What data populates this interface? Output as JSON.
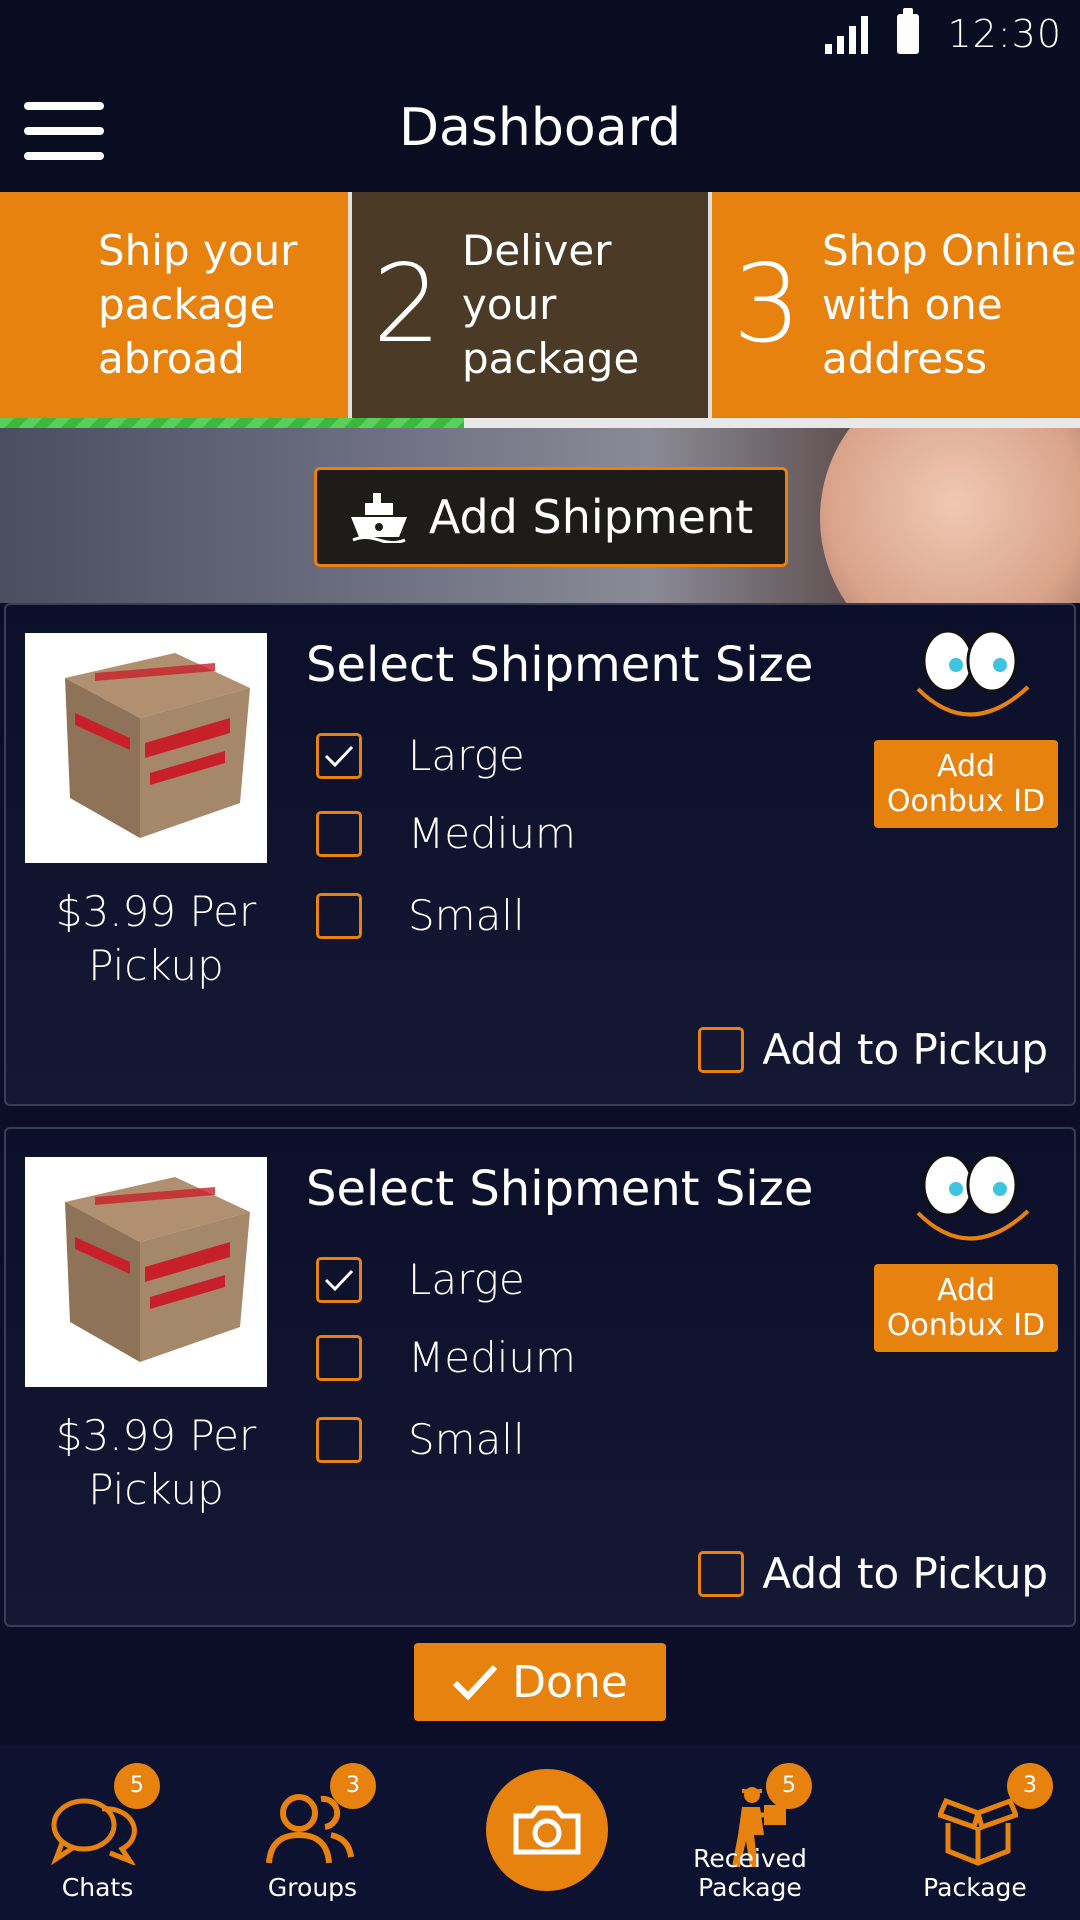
{
  "status_bar": {
    "time": "12:30"
  },
  "app_bar": {
    "title": "Dashboard"
  },
  "steps": [
    {
      "number": "",
      "label_lines": [
        "Ship your",
        "package",
        "abroad"
      ]
    },
    {
      "number": "2",
      "label_lines": [
        "Deliver",
        "your",
        "package"
      ]
    },
    {
      "number": "3",
      "label_lines": [
        "Shop Online",
        "with one",
        "address"
      ]
    }
  ],
  "progress": {
    "fraction": 0.43
  },
  "add_shipment": {
    "label": "Add Shipment"
  },
  "shipment_cards": [
    {
      "price_lines": [
        "$3.99 Per",
        "Pickup"
      ],
      "size_title": "Select Shipment Size",
      "options": [
        {
          "label": "Large",
          "checked": true
        },
        {
          "label": "Medium",
          "checked": false
        },
        {
          "label": "Small",
          "checked": false
        }
      ],
      "oonbux_lines": [
        "Add",
        "Oonbux ID"
      ],
      "pickup_label": "Add to Pickup"
    },
    {
      "price_lines": [
        "$3.99 Per",
        "Pickup"
      ],
      "size_title": "Select Shipment Size",
      "options": [
        {
          "label": "Large",
          "checked": true
        },
        {
          "label": "Medium",
          "checked": false
        },
        {
          "label": "Small",
          "checked": false
        }
      ],
      "oonbux_lines": [
        "Add",
        "Oonbux ID"
      ],
      "pickup_label": "Add to Pickup"
    }
  ],
  "done": {
    "label": "Done"
  },
  "bottom_nav": {
    "items": [
      {
        "label": "Chats",
        "icon": "chat-bubbles-icon",
        "badge": "5"
      },
      {
        "label": "Groups",
        "icon": "users-icon",
        "badge": "3"
      },
      {
        "label": "",
        "icon": "camera-icon",
        "badge": ""
      },
      {
        "label": "Received Package",
        "icon": "delivery-man-icon",
        "badge": "5"
      },
      {
        "label": "Package",
        "icon": "open-box-icon",
        "badge": "3"
      }
    ]
  },
  "colors": {
    "accent": "#e8820e",
    "background": "#0b0e26",
    "step_active": "#4a3a26",
    "progress": "#3cb83c"
  }
}
